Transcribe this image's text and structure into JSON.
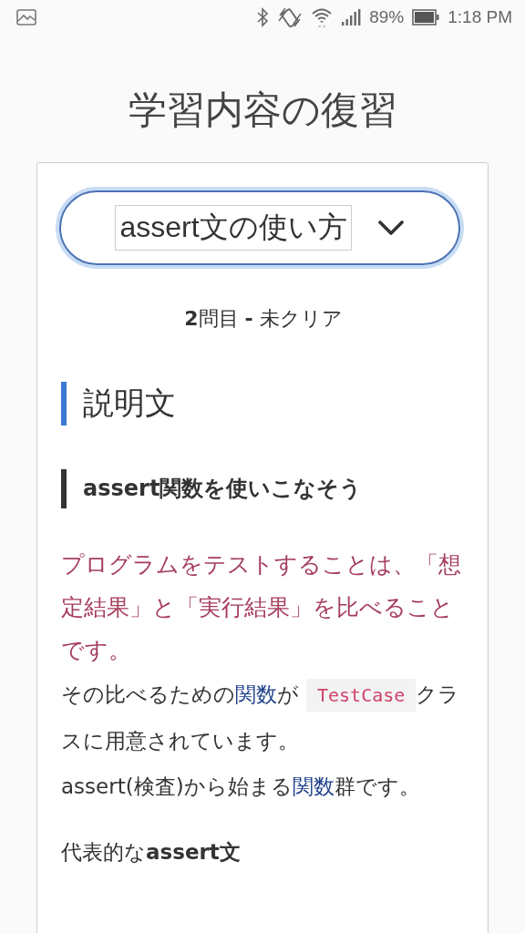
{
  "status_bar": {
    "battery_text": "89%",
    "time": "1:18 PM"
  },
  "title": "学習内容の復習",
  "lesson_select": {
    "value": "assert文の使い方"
  },
  "progress": "**2**問目 **-** 未クリア",
  "section_heading": "説明文",
  "sub_heading": "assert関数を使いこなそう",
  "highlight_paragraph": "プログラムをテストすることは、「想定結果」と「実行結果」を比べることです。",
  "body_lines": [
    [
      {
        "kind": "plain",
        "text": "その比べるための"
      },
      {
        "kind": "term",
        "text": "関数"
      },
      {
        "kind": "plain",
        "text": "が"
      },
      {
        "kind": "code",
        "text": "TestCase"
      },
      {
        "kind": "plain",
        "text": "クラスに用意されています。"
      }
    ],
    [
      {
        "kind": "plain",
        "text": "assert(検査)から始まる"
      },
      {
        "kind": "term",
        "text": "関数"
      },
      {
        "kind": "plain",
        "text": "群です。"
      }
    ]
  ],
  "list_heading": "代表的な**assert文**"
}
